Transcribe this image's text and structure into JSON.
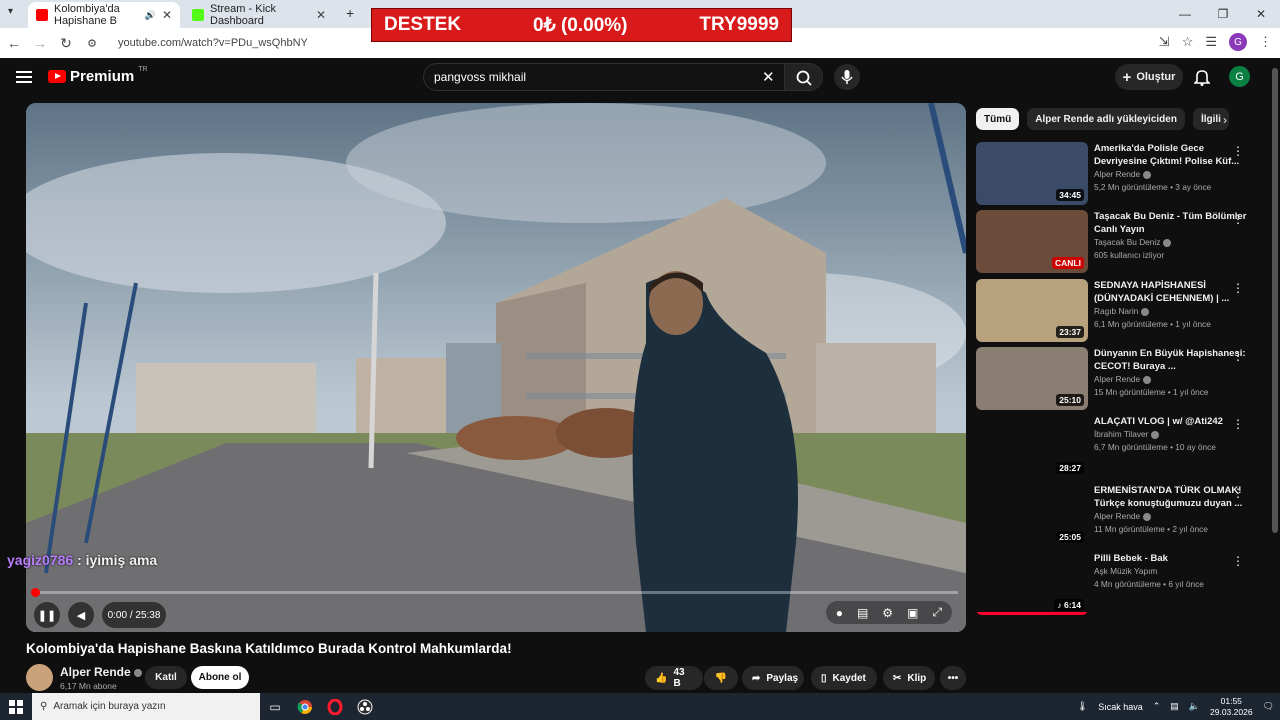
{
  "browser": {
    "tabs": [
      {
        "label": "Kolombiya'da Hapishane B",
        "active": true,
        "favicon_color": "#ff0000"
      },
      {
        "label": "Stream - Kick Dashboard",
        "active": false,
        "favicon_color": "#53fc18"
      }
    ],
    "new_tab": "+",
    "url": "youtube.com/watch?v=PDu_wsQhbNY",
    "profile_initial": "G"
  },
  "overlay_banner": {
    "left": "DESTEK",
    "center": "0₺ (0.00%)",
    "right": "TRY9999"
  },
  "youtube": {
    "logo_text": "Premium",
    "logo_region": "TR",
    "search_value": "pangvoss mikhail",
    "create_label": "Oluştur",
    "account_initial": "G"
  },
  "player": {
    "chat_user": "yagiz0786",
    "chat_message": ": iyimiş ama",
    "time": "0:00 / 25:38",
    "progress_fraction": 0.0
  },
  "video": {
    "title": "Kolombiya'da Hapishane Baskına Katıldımco Burada Kontrol Mahkumlarda!",
    "channel": "Alper Rende",
    "subscribers": "6,17 Mn abone",
    "join_label": "Katıl",
    "subscribe_label": "Abone ol",
    "likes": "43 B",
    "share_label": "Paylaş",
    "save_label": "Kaydet",
    "clip_label": "Klip",
    "more_label": "•••"
  },
  "chips": [
    "Tümü",
    "Alper Rende adlı yükleyiciden",
    "İlgili"
  ],
  "recommendations": [
    {
      "title": "Amerika'da Polisle Gece Devriyesine Çıktım! Polise Küf...",
      "channel": "Alper Rende",
      "meta": "5,2 Mn görüntüleme • 3 ay önce",
      "duration": "34:45",
      "live": false,
      "thumb_color": "#3b4a66"
    },
    {
      "title": "Taşacak Bu Deniz - Tüm Bölümler Canlı Yayın",
      "channel": "Taşacak Bu Deniz",
      "meta": "605 kullanıcı izliyor",
      "duration": "CANLI",
      "live": true,
      "thumb_color": "#6b4b3a"
    },
    {
      "title": "SEDNAYA HAPİSHANESİ (DÜNYADAKİ CEHENNEM) | ...",
      "channel": "Ragıb Narin",
      "meta": "6,1 Mn görüntüleme • 1 yıl önce",
      "duration": "23:37",
      "live": false,
      "thumb_color": "#b8a27d"
    },
    {
      "title": "Dünyanın En Büyük Hapishanesi: CECOT! Buraya ...",
      "channel": "Alper Rende",
      "meta": "15 Mn görüntüleme • 1 yıl önce",
      "duration": "25:10",
      "live": false,
      "thumb_color": "#8a7e72"
    },
    {
      "title": "ALAÇATI VLOG | w/ @Ati242",
      "channel": "İbrahim Tilaver",
      "meta": "6,7 Mn görüntüleme • 10 ay önce",
      "duration": "28:27",
      "live": false,
      "thumb_color": "#0f0f0f"
    },
    {
      "title": "ERMENİSTAN'DA TÜRK OLMAK! Türkçe konuştuğumuzu duyan ...",
      "channel": "Alper Rende",
      "meta": "11 Mn görüntüleme • 2 yıl önce",
      "duration": "25:05",
      "live": false,
      "thumb_color": "#0f0f0f"
    },
    {
      "title": "Pilli Bebek - Bak",
      "channel": "Aşk Müzik Yapım",
      "meta": "4 Mn görüntüleme • 6 yıl önce",
      "duration": "♪ 6:14",
      "live": false,
      "thumb_color": "#0f0f0f"
    }
  ],
  "taskbar": {
    "search_placeholder": "Aramak için buraya yazın",
    "weather": "Sıcak hava",
    "time": "01:55",
    "date": "29.03.2026"
  }
}
